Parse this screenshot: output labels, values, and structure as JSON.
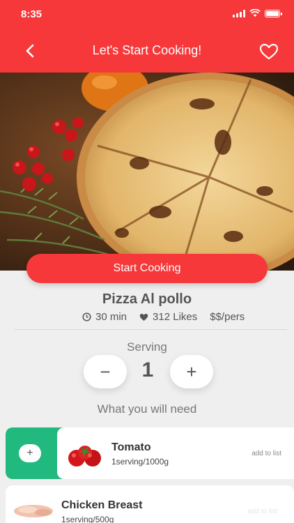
{
  "status_bar": {
    "time": "8:35"
  },
  "header": {
    "title": "Let's Start Cooking!"
  },
  "hero": {
    "image": "pizza-photo"
  },
  "start_button": {
    "label": "Start Cooking"
  },
  "recipe": {
    "name": "Pizza Al pollo",
    "time": "30 min",
    "likes": "312 Likes",
    "price": "$$/pers"
  },
  "serving": {
    "label": "Serving",
    "value": "1",
    "minus": "−",
    "plus": "+"
  },
  "need_label": "What you will need",
  "ingredients": [
    {
      "name": "Tomato",
      "quantity": "1serving/1000g",
      "action": "add to list",
      "icon": "tomato-image",
      "add_icon": "+"
    },
    {
      "name": "Chicken Breast",
      "quantity": "1serving/500g",
      "action": "add to list",
      "icon": "chicken-image"
    }
  ],
  "colors": {
    "primary": "#f7383a",
    "accent_green": "#22b97f",
    "background": "#efefef"
  }
}
